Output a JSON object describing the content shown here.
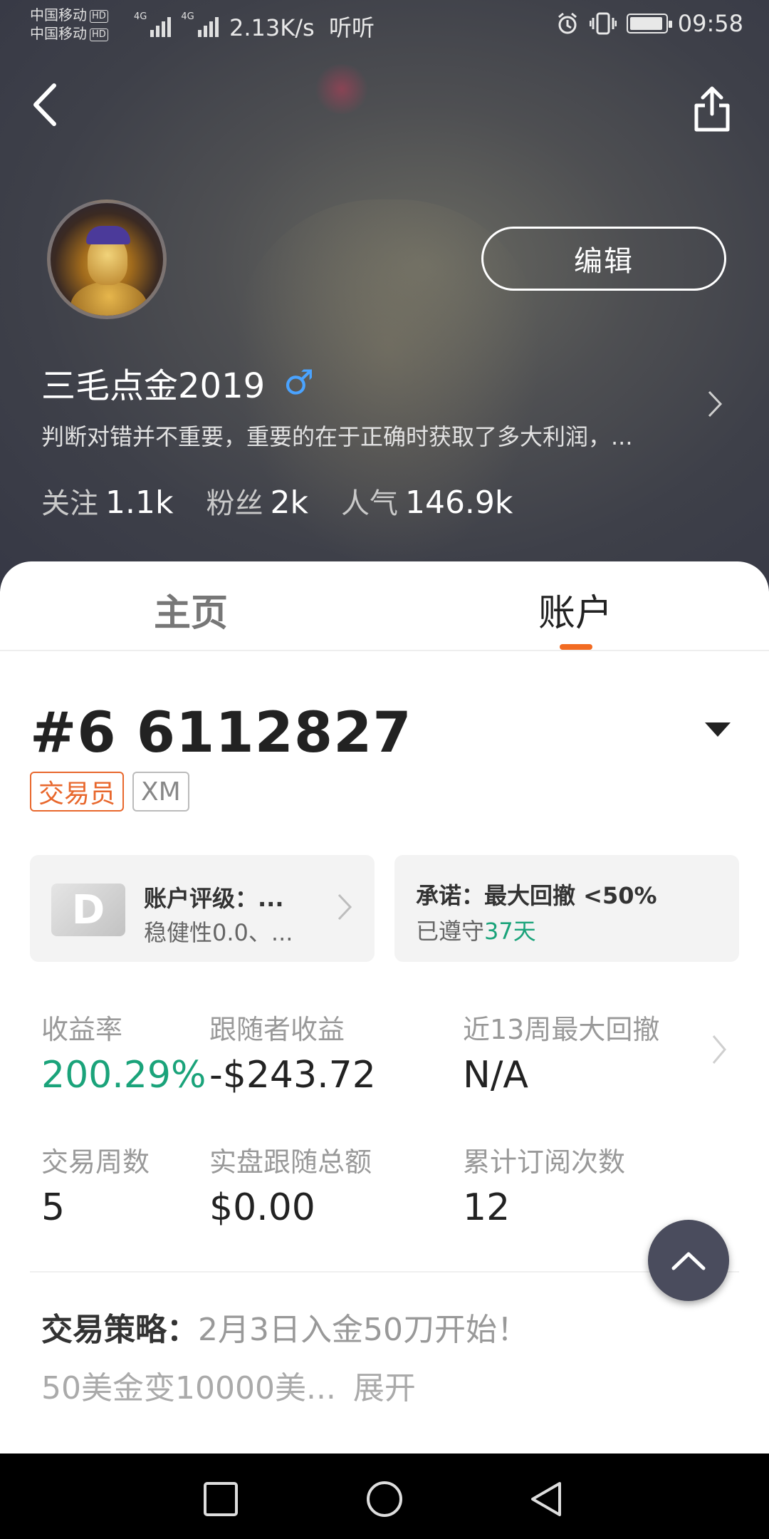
{
  "status_bar": {
    "carrier_1": "中国移动",
    "carrier_2": "中国移动",
    "hd": "HD",
    "network": "4G",
    "speed": "2.13K/s",
    "app_indicator": "听听",
    "time": "09:58",
    "icons": [
      "alarm-icon",
      "vibrate-icon",
      "battery-icon"
    ],
    "battery_level": 0.95
  },
  "header": {
    "back_icon": "chevron-left-icon",
    "share_icon": "share-icon",
    "edit_label": "编辑",
    "username": "三毛点金2019",
    "gender_symbol": "♂",
    "bio": "判断对错并不重要，重要的在于正确时获取了多大利润，...",
    "stats": [
      {
        "label": "关注",
        "value": "1.1k"
      },
      {
        "label": "粉丝",
        "value": "2k"
      },
      {
        "label": "人气",
        "value": "146.9k"
      }
    ]
  },
  "tabs": [
    {
      "label": "主页",
      "active": false
    },
    {
      "label": "账户",
      "active": true
    }
  ],
  "account": {
    "id": "#6 6112827",
    "badges": [
      "交易员",
      "XM"
    ],
    "rating": {
      "grade": "D",
      "title": "账户评级：...",
      "subtitle": "稳健性0.0、..."
    },
    "promise": {
      "title": "承诺：最大回撤 <50%",
      "kept_prefix": "已遵守",
      "kept_days": "37天"
    },
    "metrics": [
      {
        "label": "收益率",
        "value": "200.29%"
      },
      {
        "label": "跟随者收益",
        "value": "-$243.72"
      },
      {
        "label": "近13周最大回撤",
        "value": "N/A"
      },
      {
        "label": "交易周数",
        "value": "5"
      },
      {
        "label": "实盘跟随总额",
        "value": "$0.00"
      },
      {
        "label": "累计订阅次数",
        "value": "12"
      }
    ],
    "strategy": {
      "label": "交易策略：",
      "line1": "2月3日入金50刀开始！",
      "line2": "50美金变10000美...",
      "expand": "展开"
    }
  },
  "colors": {
    "accent_orange": "#f26b22",
    "badge_orange": "#e8672c",
    "gain_green": "#1aa37a",
    "gender_blue": "#4aa3ff",
    "fab_bg": "#4a4c5d"
  }
}
